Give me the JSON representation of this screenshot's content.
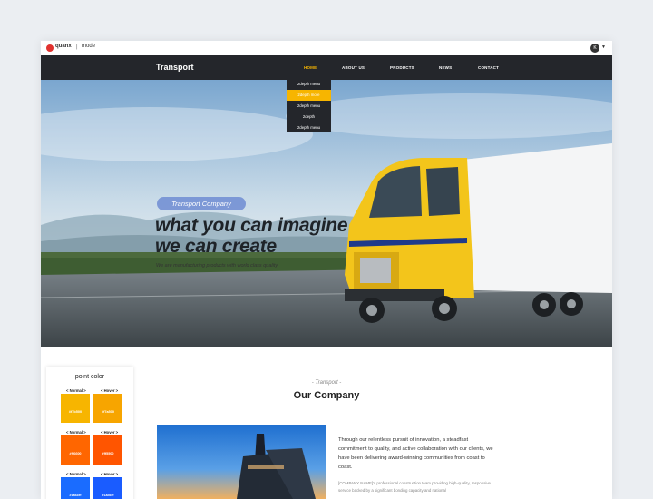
{
  "utilbar": {
    "logo_text": "quanx",
    "logo_sep": "|",
    "logo_text2": "mode",
    "lang": "K"
  },
  "nav": {
    "brand": "Transport",
    "items": [
      "HOME",
      "ABOUT US",
      "PRODUCTS",
      "NEWS",
      "CONTACT"
    ],
    "dropdown": [
      "2depth menu",
      "2depth more",
      "2depth menu",
      "2depth",
      "2depth menu"
    ]
  },
  "hero": {
    "badge": "Transport Company",
    "headline_1": "what you can imagine",
    "headline_2": "we can create",
    "subline": "We are manufacturing products with world class quality"
  },
  "panel": {
    "title": "point color",
    "normal_label": "< Normal >",
    "hover_label": "< Hover >",
    "swatches": [
      {
        "normal": "#f7b500",
        "hover": "#f7a500"
      },
      {
        "normal": "#ff6600",
        "hover": "#ff5500"
      },
      {
        "normal": "#1a6cff",
        "hover": "#1a5cff"
      }
    ],
    "swatch_text": [
      "#f7b500",
      "#f7a500",
      "#ff6600",
      "#ff5500",
      "#1a6cff",
      "#1a5cff"
    ]
  },
  "company": {
    "sub": "- Transport -",
    "title": "Our Company",
    "para1": "Through our relentless pursuit of innovation, a steadfast commitment to quality, and active collaboration with our clients, we have been delivering award-winning communities from coast to coast.",
    "para2": "[COMPANY NAME]'s professional construction team providing high-quality, responsive service backed by a significant bonding capacity and national"
  },
  "colors": {
    "accent": "#f7b500",
    "nav_bg": "#24262b"
  }
}
